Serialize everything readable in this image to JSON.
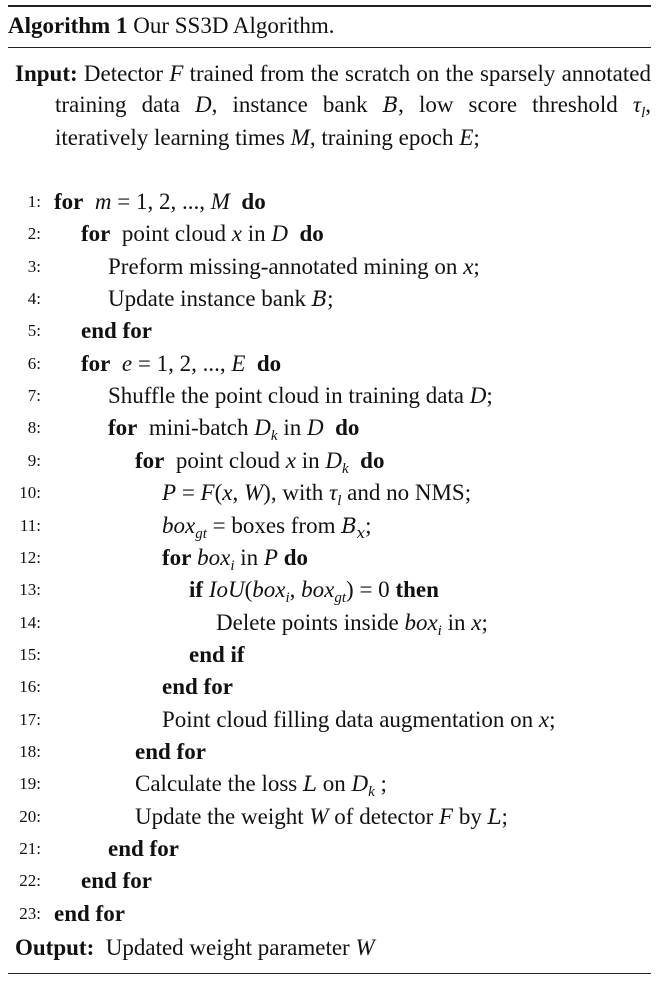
{
  "title": {
    "label": "Algorithm 1",
    "text": " Our SS3D Algorithm."
  },
  "input": {
    "label": "Input:",
    "segments": [
      {
        "t": " Detector "
      },
      {
        "m": "F"
      },
      {
        "t": " trained from the scratch on the sparsely annotated training data "
      },
      {
        "m": "D"
      },
      {
        "t": ", instance bank "
      },
      {
        "c": "B"
      },
      {
        "t": ", low score threshold "
      },
      {
        "m": "τ",
        "sub": "l"
      },
      {
        "t": ", iteratively learning times "
      },
      {
        "m": "M"
      },
      {
        "t": ", training epoch "
      },
      {
        "m": "E"
      },
      {
        "t": ";"
      }
    ]
  },
  "lines": [
    {
      "num": "1:",
      "indent": 0,
      "segments": [
        {
          "b": "for"
        },
        {
          "t": "  "
        },
        {
          "m": "m"
        },
        {
          "t": " = 1, 2, ..., "
        },
        {
          "m": "M"
        },
        {
          "t": "  "
        },
        {
          "b": "do"
        }
      ]
    },
    {
      "num": "2:",
      "indent": 1,
      "segments": [
        {
          "b": "for"
        },
        {
          "t": "  point cloud "
        },
        {
          "m": "x"
        },
        {
          "t": " in "
        },
        {
          "m": "D"
        },
        {
          "t": "  "
        },
        {
          "b": "do"
        }
      ]
    },
    {
      "num": "3:",
      "indent": 2,
      "segments": [
        {
          "t": "Preform missing-annotated mining on "
        },
        {
          "m": "x"
        },
        {
          "t": ";"
        }
      ]
    },
    {
      "num": "4:",
      "indent": 2,
      "segments": [
        {
          "t": "Update instance bank "
        },
        {
          "c": "B"
        },
        {
          "t": ";"
        }
      ]
    },
    {
      "num": "5:",
      "indent": 1,
      "segments": [
        {
          "b": "end for"
        }
      ]
    },
    {
      "num": "6:",
      "indent": 1,
      "segments": [
        {
          "b": "for"
        },
        {
          "t": "  "
        },
        {
          "m": "e"
        },
        {
          "t": " = 1, 2, ..., "
        },
        {
          "m": "E"
        },
        {
          "t": "  "
        },
        {
          "b": "do"
        }
      ]
    },
    {
      "num": "7:",
      "indent": 2,
      "segments": [
        {
          "t": "Shuffle the point cloud in training data "
        },
        {
          "m": "D"
        },
        {
          "t": ";"
        }
      ]
    },
    {
      "num": "8:",
      "indent": 2,
      "segments": [
        {
          "b": "for"
        },
        {
          "t": "  mini-batch "
        },
        {
          "m": "D",
          "sub": "k"
        },
        {
          "t": " in "
        },
        {
          "m": "D"
        },
        {
          "t": "  "
        },
        {
          "b": "do"
        }
      ]
    },
    {
      "num": "9:",
      "indent": 3,
      "segments": [
        {
          "b": "for"
        },
        {
          "t": "  point cloud "
        },
        {
          "m": "x"
        },
        {
          "t": " in "
        },
        {
          "m": "D",
          "sub": "k"
        },
        {
          "t": "  "
        },
        {
          "b": "do"
        }
      ]
    },
    {
      "num": "10:",
      "indent": 4,
      "segments": [
        {
          "m": "P"
        },
        {
          "t": " = "
        },
        {
          "m": "F"
        },
        {
          "t": "("
        },
        {
          "m": "x"
        },
        {
          "t": ", "
        },
        {
          "m": "W"
        },
        {
          "t": "), with "
        },
        {
          "m": "τ",
          "sub": "l"
        },
        {
          "t": " and no NMS;"
        }
      ]
    },
    {
      "num": "11:",
      "indent": 4,
      "segments": [
        {
          "m": "box",
          "sub": "gt"
        },
        {
          "t": " = boxes from "
        },
        {
          "c": "B",
          "sub": "x"
        },
        {
          "t": ";"
        }
      ]
    },
    {
      "num": "12:",
      "indent": 4,
      "segments": [
        {
          "b": "for"
        },
        {
          "t": " "
        },
        {
          "m": "box",
          "sub": "i"
        },
        {
          "t": " in "
        },
        {
          "m": "P"
        },
        {
          "t": " "
        },
        {
          "b": "do"
        }
      ]
    },
    {
      "num": "13:",
      "indent": 5,
      "segments": [
        {
          "b": "if"
        },
        {
          "t": " "
        },
        {
          "m": "IoU"
        },
        {
          "t": "("
        },
        {
          "m": "box",
          "sub": "i"
        },
        {
          "t": ", "
        },
        {
          "m": "box",
          "sub": "gt"
        },
        {
          "t": ") = 0 "
        },
        {
          "b": "then"
        }
      ]
    },
    {
      "num": "14:",
      "indent": 6,
      "segments": [
        {
          "t": "Delete points inside "
        },
        {
          "m": "box",
          "sub": "i"
        },
        {
          "t": " in "
        },
        {
          "m": "x"
        },
        {
          "t": ";"
        }
      ]
    },
    {
      "num": "15:",
      "indent": 5,
      "segments": [
        {
          "b": "end if"
        }
      ]
    },
    {
      "num": "16:",
      "indent": 4,
      "segments": [
        {
          "b": "end for"
        }
      ]
    },
    {
      "num": "17:",
      "indent": 4,
      "segments": [
        {
          "t": "Point cloud filling data augmentation on "
        },
        {
          "m": "x"
        },
        {
          "t": ";"
        }
      ]
    },
    {
      "num": "18:",
      "indent": 3,
      "segments": [
        {
          "b": "end for"
        }
      ]
    },
    {
      "num": "19:",
      "indent": 3,
      "segments": [
        {
          "t": "Calculate the loss "
        },
        {
          "c": "L"
        },
        {
          "t": " on "
        },
        {
          "m": "D",
          "sub": "k"
        },
        {
          "t": " ;"
        }
      ]
    },
    {
      "num": "20:",
      "indent": 3,
      "segments": [
        {
          "t": "Update the weight "
        },
        {
          "m": "W"
        },
        {
          "t": " of detector "
        },
        {
          "m": "F"
        },
        {
          "t": " by "
        },
        {
          "c": "L"
        },
        {
          "t": ";"
        }
      ]
    },
    {
      "num": "21:",
      "indent": 2,
      "segments": [
        {
          "b": "end for"
        }
      ]
    },
    {
      "num": "22:",
      "indent": 1,
      "segments": [
        {
          "b": "end for"
        }
      ]
    },
    {
      "num": "23:",
      "indent": 0,
      "segments": [
        {
          "b": "end for"
        }
      ]
    }
  ],
  "output": {
    "label": "Output:",
    "segments": [
      {
        "t": "  Updated weight parameter "
      },
      {
        "m": "W"
      }
    ]
  }
}
